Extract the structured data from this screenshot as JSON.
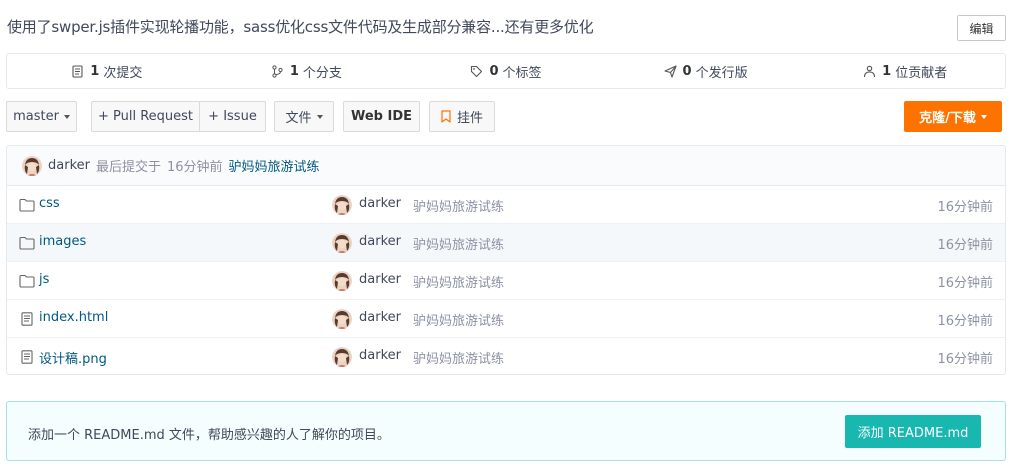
{
  "project": {
    "description": "使用了swper.js插件实现轮播功能，sass优化css文件代码及生成部分兼容...还有更多优化",
    "edit_label": "编辑"
  },
  "stats": [
    {
      "icon": "commit-icon",
      "count": "1",
      "label": "次提交"
    },
    {
      "icon": "branch-icon",
      "count": "1",
      "label": "个分支"
    },
    {
      "icon": "tag-icon",
      "count": "0",
      "label": "个标签"
    },
    {
      "icon": "release-icon",
      "count": "0",
      "label": "个发行版"
    },
    {
      "icon": "contributors-icon",
      "count": "1",
      "label": "位贡献者"
    }
  ],
  "toolbar": {
    "branch": "master",
    "pull_request": "+ Pull Request",
    "issue": "+ Issue",
    "file": "文件",
    "web_ide": "Web IDE",
    "widget": "挂件",
    "clone": "克隆/下载"
  },
  "last_commit": {
    "author": "darker",
    "text": "最后提交于",
    "time": "16分钟前",
    "message": "驴妈妈旅游试练"
  },
  "files": [
    {
      "type": "folder",
      "icon": "folder-icon",
      "name": "css",
      "author": "darker",
      "message": "驴妈妈旅游试练",
      "time": "16分钟前"
    },
    {
      "type": "folder",
      "icon": "folder-icon",
      "name": "images",
      "author": "darker",
      "message": "驴妈妈旅游试练",
      "time": "16分钟前"
    },
    {
      "type": "folder",
      "icon": "folder-icon",
      "name": "js",
      "author": "darker",
      "message": "驴妈妈旅游试练",
      "time": "16分钟前"
    },
    {
      "type": "file",
      "icon": "file-icon",
      "name": "index.html",
      "author": "darker",
      "message": "驴妈妈旅游试练",
      "time": "16分钟前"
    },
    {
      "type": "file",
      "icon": "file-icon",
      "name": "设计稿.png",
      "author": "darker",
      "message": "驴妈妈旅游试练",
      "time": "16分钟前"
    }
  ],
  "readme": {
    "hint": "添加一个 README.md 文件，帮助感兴趣的人了解你的项目。",
    "button": "添加 README.md"
  },
  "colors": {
    "accent_orange": "#fe7300",
    "link_blue": "#005980",
    "readme_teal": "#18b7b0"
  }
}
